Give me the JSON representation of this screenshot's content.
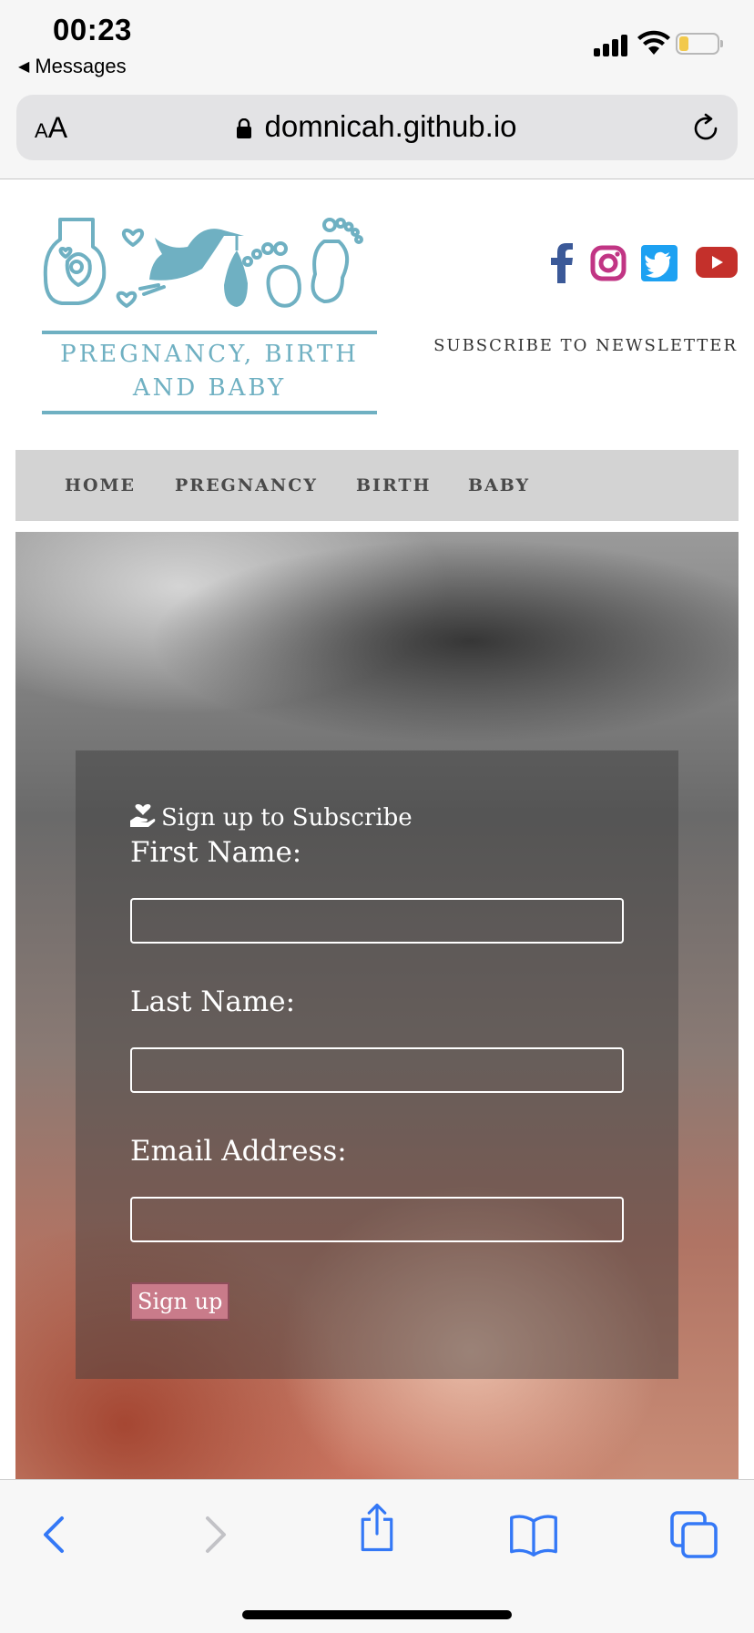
{
  "status_bar": {
    "time": "00:23",
    "back_app": "Messages",
    "battery_level": 0.25,
    "battery_color": "#f2c94c"
  },
  "browser": {
    "text_size_small": "A",
    "text_size_big": "A",
    "url": "domnicah.github.io",
    "icons": [
      "lock-icon",
      "reload-icon"
    ]
  },
  "header": {
    "logo_line1": "PREGNANCY, BIRTH",
    "logo_line2": "AND BABY",
    "brand_color": "#6fb0c2",
    "social": [
      {
        "name": "facebook-icon",
        "color": "#3b5998"
      },
      {
        "name": "instagram-icon",
        "color": "#c13584"
      },
      {
        "name": "twitter-icon",
        "color": "#1da1f2"
      },
      {
        "name": "youtube-icon",
        "color": "#c4302b"
      }
    ],
    "newsletter_link": "SUBSCRIBE TO NEWSLETTER"
  },
  "nav": {
    "items": [
      {
        "label": "HOME"
      },
      {
        "label": "PREGNANCY"
      },
      {
        "label": "BIRTH"
      },
      {
        "label": "BABY"
      }
    ]
  },
  "form": {
    "heading": "Sign up to Subscribe",
    "heading_icon": "hand-holding-heart-icon",
    "first_name_label": "First Name:",
    "first_name_value": "",
    "last_name_label": "Last Name:",
    "last_name_value": "",
    "email_label": "Email Address:",
    "email_value": "",
    "submit_label": "Sign up",
    "submit_color": "#c97b8a"
  },
  "toolbar": {
    "buttons": [
      "back-icon",
      "forward-icon",
      "share-icon",
      "bookmarks-icon",
      "tabs-icon"
    ],
    "accent": "#3478f6"
  }
}
